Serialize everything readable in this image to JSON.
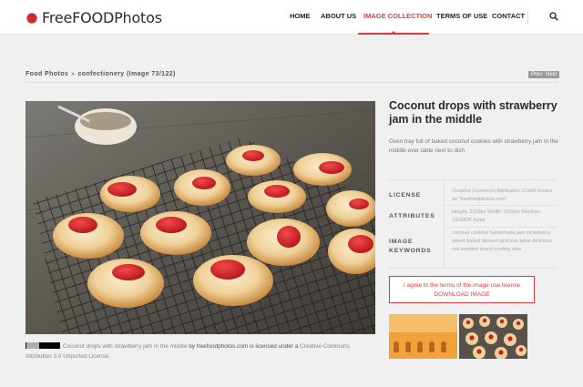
{
  "brand": {
    "name": "FreeFOODPhotos"
  },
  "nav": {
    "items": [
      {
        "label": "HOME",
        "active": false
      },
      {
        "label": "ABOUT US",
        "active": false
      },
      {
        "label": "IMAGE COLLECTION",
        "active": true
      },
      {
        "label": "TERMS OF USE",
        "active": false
      },
      {
        "label": "CONTACT",
        "active": false
      }
    ],
    "search_icon": "search-icon"
  },
  "breadcrumb": {
    "root": "Food Photos",
    "separator": "»",
    "category": "confectionery",
    "position": "(Image 73/122)"
  },
  "pager": {
    "prev": "Prev",
    "next": "Next"
  },
  "image": {
    "title": "Coconut drops with strawberry jam in the middle",
    "description": "Oven tray full of baked coconut cookies with strawberry jam in the middle over table next to dish"
  },
  "meta": {
    "license_label": "LICENSE",
    "license_value": "Creative Commons Attribution. Credit source as \"freefoodphotos.com\"",
    "attributes_label": "ATTRIBUTES",
    "attributes_value": "Height: 2329px Width: 3500px FileSize: 1816836 bytes",
    "keywords_label": "IMAGE KEYWORDS",
    "keywords_value": "coconut cookies homemade jam strawberry sweet baked dessert grid tray table delicious red wooden round cooling wire"
  },
  "download": {
    "agree_text": "I agree to the terms of the image use license",
    "button_label": "DOWNLOAD IMAGE"
  },
  "license_line": {
    "badge": "cc-by-badge",
    "work": "Coconut drops with strawberry jam in the middle",
    "by": "by",
    "site": "freefoodphotos.com",
    "licensed": "is licensed under a",
    "license_name": "Creative Commons Attribution 3.0 Unported License."
  },
  "colors": {
    "accent": "#e13a3e",
    "page_bg": "#f0f0f0"
  }
}
